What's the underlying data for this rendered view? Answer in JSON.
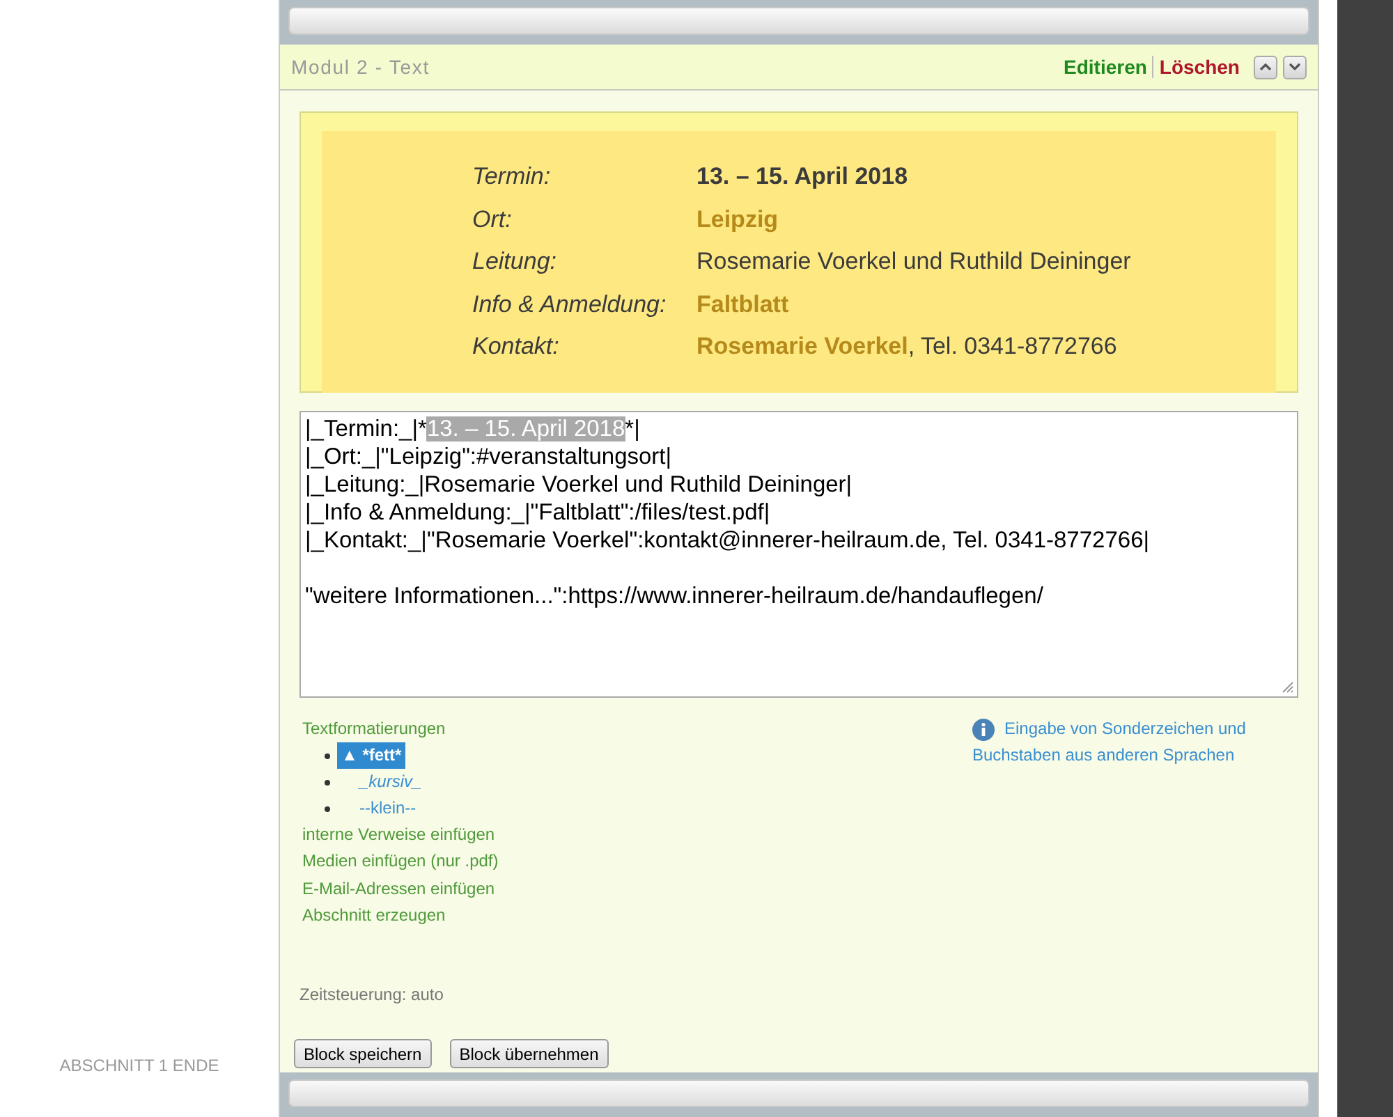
{
  "section_end": "ABSCHNITT 1 ENDE",
  "module": {
    "title": "Modul 2 - Text",
    "actions": [
      {
        "label": "Editieren",
        "kind": "edit"
      },
      {
        "label": "Löschen",
        "kind": "delete"
      }
    ]
  },
  "preview": {
    "rows": [
      {
        "label": "Termin:",
        "value": [
          {
            "text": "13. – 15. April 2018",
            "kind": "bold"
          }
        ]
      },
      {
        "label": "Ort:",
        "value": [
          {
            "text": "Leipzig",
            "kind": "link"
          }
        ]
      },
      {
        "label": "Leitung:",
        "value": [
          {
            "text": "Rosemarie Voerkel und Ruthild Deininger",
            "kind": "plain"
          }
        ]
      },
      {
        "label": "Info & Anmeldung:",
        "value": [
          {
            "text": "Faltblatt",
            "kind": "link"
          }
        ]
      },
      {
        "label": "Kontakt:",
        "value": [
          {
            "text": "Rosemarie Voerkel",
            "kind": "link"
          },
          {
            "text": ", Tel. 0341-8772766",
            "kind": "plain"
          }
        ]
      }
    ]
  },
  "editor": {
    "paragraphs": [
      [
        {
          "before": "|_Termin:_|*",
          "selection": "13. – 15. April 2018",
          "after": "*|"
        },
        {
          "before": "|_Ort:_|\"Leipzig\":#veranstaltungsort|"
        },
        {
          "before": "|_Leitung:_|Rosemarie Voerkel und Ruthild Deininger|"
        },
        {
          "before": "|_Info & Anmeldung:_|\"Faltblatt\":/files/test.pdf|"
        },
        {
          "before": "|_Kontakt:_|\"Rosemarie Voerkel\":kontakt@innerer-heilraum.de, Tel. 0341-8772766|"
        }
      ],
      [
        {
          "before": "\"weitere Informationen...\":https://www.innerer-heilraum.de/handauflegen/"
        }
      ]
    ]
  },
  "help": {
    "heading": "Textformatierungen",
    "formats": [
      {
        "label": "▲ *fett*",
        "selected": true
      },
      {
        "label": "_kursiv_",
        "selected": false
      },
      {
        "label": "--klein--",
        "selected": false
      }
    ],
    "links": [
      "interne Verweise einfügen",
      "Medien einfügen (nur .pdf)",
      "E-Mail-Adressen einfügen",
      "Abschnitt erzeugen"
    ],
    "special_chars": "Eingabe von Sonderzeichen und Buchstaben aus anderen Sprachen"
  },
  "timing": "Zeitsteuerung: auto",
  "buttons": [
    "Block speichern",
    "Block übernehmen"
  ]
}
